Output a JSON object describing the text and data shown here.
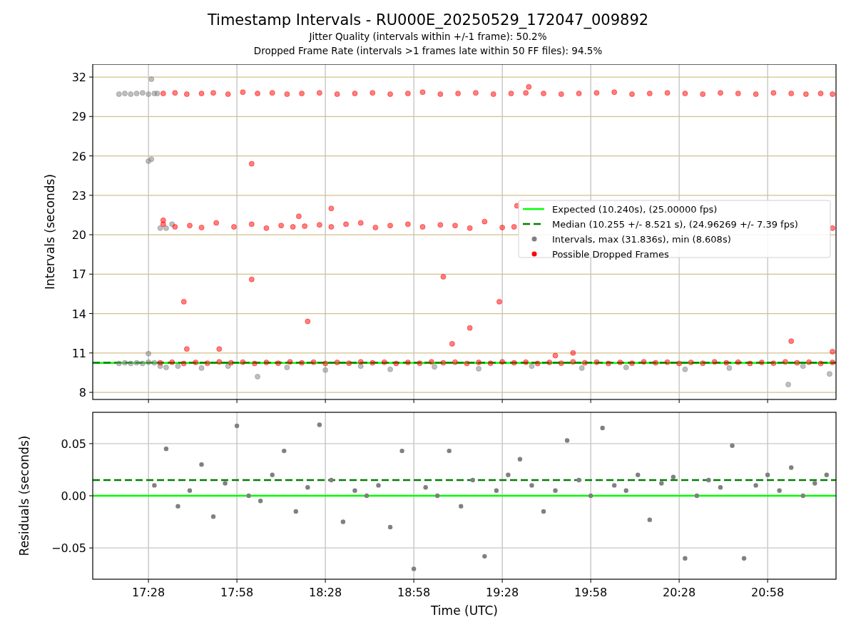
{
  "title": "Timestamp Intervals - RU000E_20250529_172047_009892",
  "subtitles": [
    "Jitter Quality (intervals within +/-1 frame): 50.2%",
    "Dropped Frame Rate (intervals >1 frames late within 50 FF files): 94.5%"
  ],
  "plots": [
    {
      "chart_data": {
        "type": "scatter",
        "ylabel": "Intervals (seconds)",
        "xlim": [
          1029.1,
          1281.2
        ],
        "ylim": [
          7.46,
          32.98
        ],
        "grid": true,
        "yticks": [
          {
            "value": 8,
            "label": "8"
          },
          {
            "value": 11,
            "label": "11"
          },
          {
            "value": 14,
            "label": "14"
          },
          {
            "value": 17,
            "label": "17"
          },
          {
            "value": 20,
            "label": "20"
          },
          {
            "value": 23,
            "label": "23"
          },
          {
            "value": 26,
            "label": "26"
          },
          {
            "value": 29,
            "label": "29"
          },
          {
            "value": 32,
            "label": "32"
          }
        ],
        "legend": "center right",
        "ref_lines": [
          {
            "axis": "y",
            "value": 10.24,
            "color": "#00ff00",
            "label": "Expected (10.240s), (25.00000 fps)"
          },
          {
            "axis": "y",
            "value": 10.255,
            "color": "#008000",
            "label": "Median (10.255 +/- 8.521 s), (24.96269 +/- 7.39 fps)"
          }
        ],
        "series": [
          {
            "name": "Intervals, max (31.836s), min (8.608s)",
            "color": "#808080",
            "x": [
              1038,
              1040,
              1042,
              1044,
              1046,
              1048,
              1050,
              1051,
              1049,
              1048,
              1049,
              1052,
              1054,
              1056,
              1048,
              1038,
              1040,
              1042,
              1044,
              1046,
              1048,
              1050,
              1052,
              1054,
              1058,
              1066,
              1075,
              1085,
              1095,
              1108,
              1120,
              1130,
              1145,
              1160,
              1178,
              1195,
              1210,
              1230,
              1245,
              1265,
              1270,
              1279
            ],
            "values": [
              30.7,
              30.75,
              30.7,
              30.75,
              30.8,
              30.7,
              30.75,
              30.75,
              31.84,
              25.6,
              25.75,
              20.5,
              20.5,
              20.8,
              10.95,
              10.2,
              10.25,
              10.2,
              10.25,
              10.2,
              10.3,
              10.25,
              10.0,
              9.9,
              10.0,
              9.85,
              10.0,
              9.2,
              9.9,
              9.7,
              10.0,
              9.75,
              9.95,
              9.8,
              10.0,
              9.85,
              9.9,
              9.75,
              9.85,
              8.6,
              10.0,
              9.4
            ]
          },
          {
            "name": "Possible Dropped Frames",
            "color": "#ff0000",
            "x": [
              1053,
              1057,
              1061,
              1066,
              1070,
              1075,
              1080,
              1085,
              1090,
              1095,
              1100,
              1106,
              1112,
              1118,
              1124,
              1130,
              1136,
              1141,
              1147,
              1153,
              1159,
              1165,
              1171,
              1176,
              1177,
              1182,
              1188,
              1194,
              1200,
              1206,
              1212,
              1218,
              1224,
              1230,
              1236,
              1242,
              1248,
              1254,
              1260,
              1266,
              1271,
              1276,
              1280,
              1053,
              1057,
              1062,
              1066,
              1071,
              1077,
              1083,
              1088,
              1093,
              1097,
              1101,
              1106,
              1110,
              1115,
              1120,
              1125,
              1130,
              1136,
              1141,
              1147,
              1152,
              1157,
              1162,
              1168,
              1172,
              1280,
              1053,
              1099,
              1110,
              1173,
              1083,
              1083,
              1060,
              1102,
              1148,
              1151,
              1157,
              1167,
              1061,
              1072,
              1186,
              1192,
              1266,
              1280,
              1052,
              1056,
              1060,
              1064,
              1068,
              1072,
              1076,
              1080,
              1084,
              1088,
              1092,
              1096,
              1100,
              1104,
              1108,
              1112,
              1116,
              1120,
              1124,
              1128,
              1132,
              1136,
              1140,
              1144,
              1148,
              1152,
              1156,
              1160,
              1164,
              1168,
              1172,
              1176,
              1180,
              1184,
              1188,
              1192,
              1196,
              1200,
              1204,
              1208,
              1212,
              1216,
              1220,
              1224,
              1228,
              1232,
              1236,
              1240,
              1244,
              1248,
              1252,
              1256,
              1260,
              1264,
              1268,
              1272,
              1276,
              1280
            ],
            "values": [
              30.75,
              30.8,
              30.7,
              30.75,
              30.8,
              30.7,
              30.85,
              30.75,
              30.8,
              30.7,
              30.75,
              30.8,
              30.7,
              30.75,
              30.8,
              30.7,
              30.75,
              30.85,
              30.7,
              30.75,
              30.8,
              30.7,
              30.75,
              30.8,
              31.25,
              30.75,
              30.7,
              30.75,
              30.8,
              30.85,
              30.7,
              30.75,
              30.8,
              30.75,
              30.7,
              30.8,
              30.75,
              30.7,
              30.8,
              30.75,
              30.7,
              30.75,
              30.7,
              20.8,
              20.6,
              20.7,
              20.55,
              20.9,
              20.6,
              20.8,
              20.5,
              20.7,
              20.6,
              20.65,
              20.75,
              20.6,
              20.8,
              20.9,
              20.55,
              20.7,
              20.8,
              20.6,
              20.75,
              20.7,
              20.5,
              21.0,
              20.55,
              20.6,
              20.5,
              21.1,
              21.4,
              22.0,
              22.2,
              25.4,
              16.6,
              14.9,
              13.4,
              16.8,
              11.7,
              12.9,
              14.9,
              11.3,
              11.3,
              10.8,
              11.0,
              11.9,
              11.1,
              10.25,
              10.3,
              10.2,
              10.28,
              10.22,
              10.32,
              10.25,
              10.3,
              10.2,
              10.28,
              10.22,
              10.32,
              10.25,
              10.3,
              10.2,
              10.28,
              10.22,
              10.32,
              10.25,
              10.3,
              10.2,
              10.28,
              10.22,
              10.32,
              10.25,
              10.3,
              10.2,
              10.28,
              10.22,
              10.32,
              10.25,
              10.3,
              10.2,
              10.28,
              10.22,
              10.32,
              10.25,
              10.3,
              10.2,
              10.28,
              10.22,
              10.32,
              10.25,
              10.3,
              10.2,
              10.28,
              10.22,
              10.32,
              10.25,
              10.3,
              10.2,
              10.28,
              10.22,
              10.32,
              10.25,
              10.3,
              10.2,
              10.28
            ]
          }
        ]
      }
    },
    {
      "chart_data": {
        "type": "scatter",
        "xlabel": "Time (UTC)",
        "ylabel": "Residuals (seconds)",
        "xlim": [
          1029.1,
          1281.2
        ],
        "ylim": [
          -0.08,
          0.08
        ],
        "grid": true,
        "xticks": [
          {
            "value": 1048,
            "label": "17:28"
          },
          {
            "value": 1078,
            "label": "17:58"
          },
          {
            "value": 1108,
            "label": "18:28"
          },
          {
            "value": 1138,
            "label": "18:58"
          },
          {
            "value": 1168,
            "label": "19:28"
          },
          {
            "value": 1198,
            "label": "19:58"
          },
          {
            "value": 1228,
            "label": "20:28"
          },
          {
            "value": 1258,
            "label": "20:58"
          }
        ],
        "yticks": [
          {
            "value": -0.05,
            "label": "−0.05"
          },
          {
            "value": 0,
            "label": "0.00"
          },
          {
            "value": 0.05,
            "label": "0.05"
          }
        ],
        "ref_lines": [
          {
            "axis": "y",
            "value": 0,
            "color": "#00ff00"
          },
          {
            "axis": "y",
            "value": 0.015,
            "color": "#008000"
          }
        ],
        "series": [
          {
            "color": "#808080",
            "x": [
              1050,
              1054,
              1058,
              1062,
              1066,
              1070,
              1074,
              1078,
              1082,
              1086,
              1090,
              1094,
              1098,
              1102,
              1106,
              1110,
              1114,
              1118,
              1122,
              1126,
              1130,
              1134,
              1138,
              1142,
              1146,
              1150,
              1154,
              1158,
              1162,
              1166,
              1170,
              1174,
              1178,
              1182,
              1186,
              1190,
              1194,
              1198,
              1202,
              1206,
              1210,
              1214,
              1218,
              1222,
              1226,
              1230,
              1234,
              1238,
              1242,
              1246,
              1250,
              1254,
              1258,
              1262,
              1266,
              1270,
              1274,
              1278
            ],
            "values": [
              0.01,
              0.045,
              -0.01,
              0.005,
              0.03,
              -0.02,
              0.012,
              0.067,
              0.0,
              -0.005,
              0.02,
              0.043,
              -0.015,
              0.008,
              0.068,
              0.015,
              -0.025,
              0.005,
              0.0,
              0.01,
              -0.03,
              0.043,
              -0.07,
              0.008,
              0.0,
              0.043,
              -0.01,
              0.015,
              -0.058,
              0.005,
              0.02,
              0.035,
              0.01,
              -0.015,
              0.005,
              0.053,
              0.015,
              0.0,
              0.065,
              0.01,
              0.005,
              0.02,
              -0.023,
              0.012,
              0.018,
              -0.06,
              0.0,
              0.015,
              0.008,
              0.048,
              -0.06,
              0.01,
              0.02,
              0.005,
              0.027,
              0.0,
              0.012,
              0.02
            ]
          }
        ]
      }
    }
  ]
}
